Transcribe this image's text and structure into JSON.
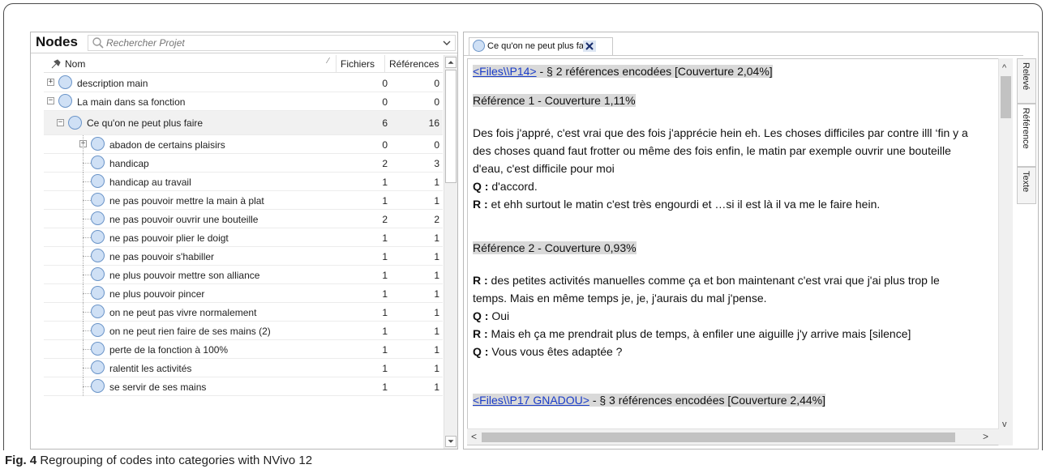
{
  "nodes_panel": {
    "title": "Nodes",
    "search_placeholder": "Rechercher Projet",
    "columns": {
      "name": "Nom",
      "files": "Fichiers",
      "references": "Références"
    },
    "rows": [
      {
        "label": "description main",
        "files": "0",
        "refs": "0",
        "level": 0,
        "expander": "+"
      },
      {
        "label": "La main dans sa fonction",
        "files": "0",
        "refs": "0",
        "level": 0,
        "expander": "−"
      },
      {
        "label": "Ce qu'on ne peut plus faire",
        "files": "6",
        "refs": "16",
        "level": 1,
        "expander": "−",
        "selected": true
      },
      {
        "label": "abadon de certains plaisirs",
        "files": "0",
        "refs": "0",
        "level": 2,
        "expander": "+"
      },
      {
        "label": "handicap",
        "files": "2",
        "refs": "3",
        "level": 2
      },
      {
        "label": "handicap au travail",
        "files": "1",
        "refs": "1",
        "level": 2
      },
      {
        "label": "ne pas pouvoir mettre la main à plat",
        "files": "1",
        "refs": "1",
        "level": 2
      },
      {
        "label": "ne pas pouvoir ouvrir une bouteille",
        "files": "2",
        "refs": "2",
        "level": 2
      },
      {
        "label": "ne pas pouvoir plier le doigt",
        "files": "1",
        "refs": "1",
        "level": 2
      },
      {
        "label": "ne pas pouvoir s'habiller",
        "files": "1",
        "refs": "1",
        "level": 2
      },
      {
        "label": "ne plus pouvoir mettre son alliance",
        "files": "1",
        "refs": "1",
        "level": 2
      },
      {
        "label": "ne plus pouvoir pincer",
        "files": "1",
        "refs": "1",
        "level": 2
      },
      {
        "label": "on ne peut pas vivre normalement",
        "files": "1",
        "refs": "1",
        "level": 2
      },
      {
        "label": "on ne peut rien faire de ses mains (2)",
        "files": "1",
        "refs": "1",
        "level": 2
      },
      {
        "label": "perte de la fonction à 100%",
        "files": "1",
        "refs": "1",
        "level": 2
      },
      {
        "label": "ralentit les activités",
        "files": "1",
        "refs": "1",
        "level": 2
      },
      {
        "label": "se servir de ses mains",
        "files": "1",
        "refs": "1",
        "level": 2
      }
    ]
  },
  "detail_panel": {
    "tab_label": "Ce qu'on ne peut plus faire",
    "header1_link": "<Files\\\\P14>",
    "header1_rest": " - § 2 références encodées  [Couverture 2,04%]",
    "ref1_title": "Référence 1 - Couverture 1,11%",
    "ref1_lines": [
      "Des fois j'appré, c'est vrai que des fois j'apprécie hein eh. Les choses difficiles par contre illl ‘fin y a",
      "des choses quand faut frotter ou même des fois enfin, le matin par exemple ouvrir une bouteille",
      "d'eau, c'est difficile pour moi"
    ],
    "ref1_q1_label": "Q :",
    "ref1_q1_text": " d'accord.",
    "ref1_r1_label": "R :",
    "ref1_r1_text": " et ehh surtout le matin c'est très engourdi et …si il est là il va me le faire hein.",
    "ref2_title": "Référence 2 - Couverture 0,93%",
    "ref2_r1_label": "R :",
    "ref2_r1_text": " des petites activités manuelles comme ça et bon maintenant c'est vrai que j'ai plus trop le",
    "ref2_r1_cont": "temps. Mais en même temps je, je, j'aurais du mal j'pense.",
    "ref2_q1_label": "Q :",
    "ref2_q1_text": " Oui",
    "ref2_r2_label": "R :",
    "ref2_r2_text": " Mais eh ça me prendrait plus de temps, à enfiler une aiguille j'y arrive mais [silence]",
    "ref2_q2_label": "Q :",
    "ref2_q2_text": " Vous vous êtes adaptée ?",
    "header2_link": "<Files\\\\P17 GNADOU>",
    "header2_rest": " - § 3 références encodées  [Couverture 2,44%]",
    "side_tabs": [
      "Relevé",
      "Référence",
      "Texte"
    ]
  },
  "caption": {
    "label": "Fig. 4",
    "text": " Regrouping of codes into categories with NVivo 12"
  },
  "colors": {
    "node_fill": "#cfe0f5",
    "node_stroke": "#6a94c8",
    "link": "#1a3cc8",
    "highlight": "#d9d9d9"
  }
}
